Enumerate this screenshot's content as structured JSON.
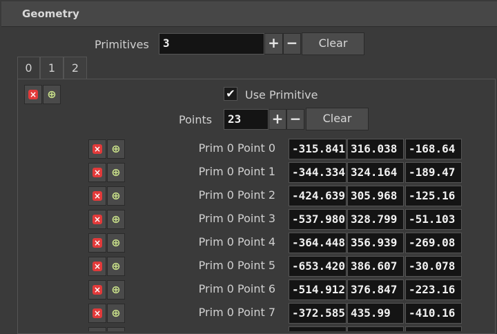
{
  "header": {
    "title": "Geometry"
  },
  "primitives": {
    "label": "Primitives",
    "value": "3",
    "plus": "+",
    "minus": "−",
    "clear": "Clear"
  },
  "tabs": [
    "0",
    "1",
    "2"
  ],
  "use_primitive": {
    "label": "Use Primitive",
    "checked": true,
    "mark": "✔"
  },
  "points_ctrl": {
    "label": "Points",
    "value": "23",
    "plus": "+",
    "minus": "−",
    "clear": "Clear"
  },
  "row_buttons": {
    "delete_glyph": "×",
    "insert_glyph": "⊕"
  },
  "points": [
    {
      "label": "Prim 0 Point 0",
      "x": "-315.841",
      "y": "316.038",
      "z": "-168.64"
    },
    {
      "label": "Prim 0 Point 1",
      "x": "-344.334",
      "y": "324.164",
      "z": "-189.47"
    },
    {
      "label": "Prim 0 Point 2",
      "x": "-424.639",
      "y": "305.968",
      "z": "-125.16"
    },
    {
      "label": "Prim 0 Point 3",
      "x": "-537.980",
      "y": "328.799",
      "z": "-51.103"
    },
    {
      "label": "Prim 0 Point 4",
      "x": "-364.448",
      "y": "356.939",
      "z": "-269.08"
    },
    {
      "label": "Prim 0 Point 5",
      "x": "-653.420",
      "y": "386.607",
      "z": "-30.078"
    },
    {
      "label": "Prim 0 Point 6",
      "x": "-514.912",
      "y": "376.847",
      "z": "-223.16"
    },
    {
      "label": "Prim 0 Point 7",
      "x": "-372.585",
      "y": "435.99",
      "z": "-410.16"
    }
  ]
}
